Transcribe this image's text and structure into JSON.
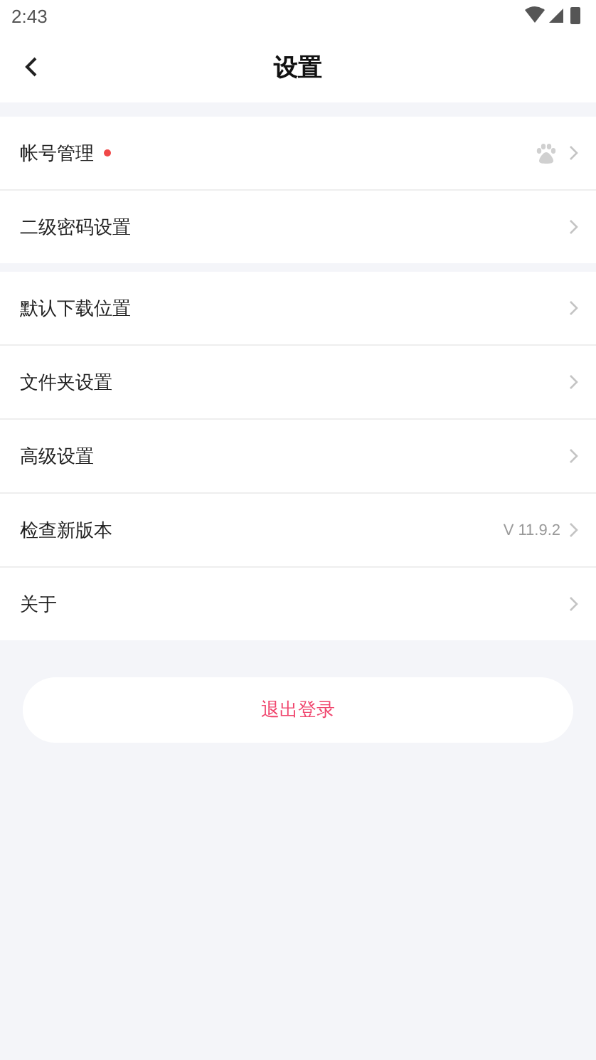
{
  "status_bar": {
    "time": "2:43"
  },
  "header": {
    "title": "设置"
  },
  "groups": [
    {
      "items": [
        {
          "label": "帐号管理",
          "badge": true,
          "icon": true
        },
        {
          "label": "二级密码设置",
          "badge": false
        }
      ]
    },
    {
      "items": [
        {
          "label": "默认下载位置",
          "badge": false
        },
        {
          "label": "文件夹设置",
          "badge": false
        },
        {
          "label": "高级设置",
          "badge": false
        },
        {
          "label": "检查新版本",
          "badge": false,
          "value": "V 11.9.2"
        },
        {
          "label": "关于",
          "badge": false
        }
      ]
    }
  ],
  "logout_button": "退出登录"
}
